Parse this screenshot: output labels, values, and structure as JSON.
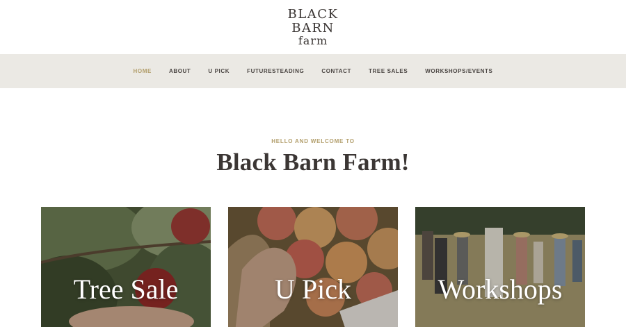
{
  "logo": {
    "line1": "BLACK",
    "line2": "BARN",
    "line3": "farm"
  },
  "nav": [
    {
      "label": "HOME",
      "active": true
    },
    {
      "label": "ABOUT"
    },
    {
      "label": "U PICK"
    },
    {
      "label": "FUTURESTEADING"
    },
    {
      "label": "CONTACT"
    },
    {
      "label": "TREE SALES"
    },
    {
      "label": "WORKSHOPS/EVENTS"
    }
  ],
  "welcome": {
    "eyebrow": "HELLO AND WELCOME TO",
    "title": "Black Barn Farm!"
  },
  "cards": [
    {
      "label": "Tree Sale"
    },
    {
      "label": "U Pick"
    },
    {
      "label": "Workshops"
    }
  ],
  "colors": {
    "accent": "#b29e6b",
    "nav_bg": "#ebe9e4",
    "text": "#3b3634"
  }
}
